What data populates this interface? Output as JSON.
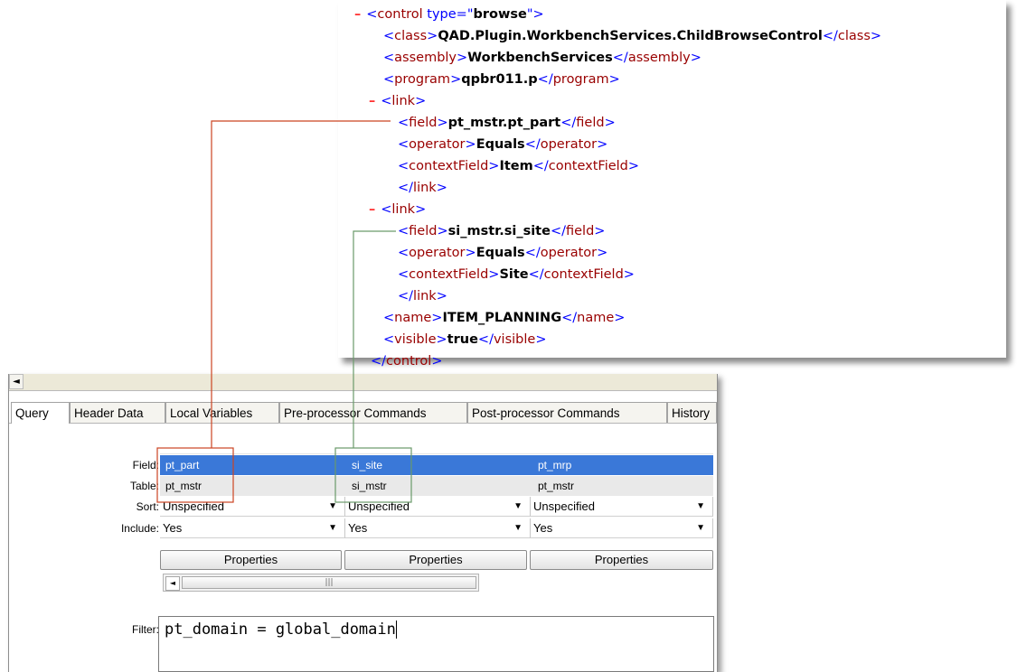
{
  "xml": {
    "lines": [
      {
        "toggle": "–",
        "open": "<control type=\"",
        "attr": "browse",
        "close": "\">"
      },
      {
        "otag": "<class>",
        "val": "QAD.Plugin.WorkbenchServices.ChildBrowseControl",
        "ctag": "</class>"
      },
      {
        "otag": "<assembly>",
        "val": "WorkbenchServices",
        "ctag": "</assembly>"
      },
      {
        "otag": "<program>",
        "val": "qpbr011.p",
        "ctag": "</program>"
      },
      {
        "toggle": "–",
        "otag": "<link>"
      },
      {
        "otag": "<field>",
        "val": "pt_mstr.pt_part",
        "ctag": "</field>"
      },
      {
        "otag": "<operator>",
        "val": "Equals",
        "ctag": "</operator>"
      },
      {
        "otag": "<contextField>",
        "val": "Item",
        "ctag": "</contextField>"
      },
      {
        "otag": "</link>"
      },
      {
        "toggle": "–",
        "otag": "<link>"
      },
      {
        "otag": "<field>",
        "val": "si_mstr.si_site",
        "ctag": "</field>"
      },
      {
        "otag": "<operator>",
        "val": "Equals",
        "ctag": "</operator>"
      },
      {
        "otag": "<contextField>",
        "val": "Site",
        "ctag": "</contextField>"
      },
      {
        "otag": "</link>"
      },
      {
        "otag": "<name>",
        "val": "ITEM_PLANNING",
        "ctag": "</name>"
      },
      {
        "otag": "<visible>",
        "val": "true",
        "ctag": "</visible>"
      },
      {
        "otag": "</control>"
      }
    ]
  },
  "designer": {
    "tabs": [
      "Query",
      "Header Data",
      "Local Variables",
      "Pre-processor Commands",
      "Post-processor Commands",
      "History"
    ],
    "labels": {
      "field": "Field:",
      "table": "Table:",
      "sort": "Sort:",
      "include": "Include:",
      "filter": "Filter:"
    },
    "columns": [
      {
        "field": "pt_part",
        "table": "pt_mstr",
        "sort": "Unspecified",
        "include": "Yes",
        "button": "Properties"
      },
      {
        "field": "si_site",
        "table": "si_mstr",
        "sort": "Unspecified",
        "include": "Yes",
        "button": "Properties"
      },
      {
        "field": "pt_mrp",
        "table": "pt_mstr",
        "sort": "Unspecified",
        "include": "Yes",
        "button": "Properties"
      }
    ],
    "filter_value": "pt_domain = global_domain",
    "scroll_left_arrow": "◄",
    "scroll_thumb_grip": "|||"
  },
  "colors": {
    "selection": "#3a78d8",
    "connector_red": "#cc4422",
    "connector_green": "#6a9a6a"
  }
}
